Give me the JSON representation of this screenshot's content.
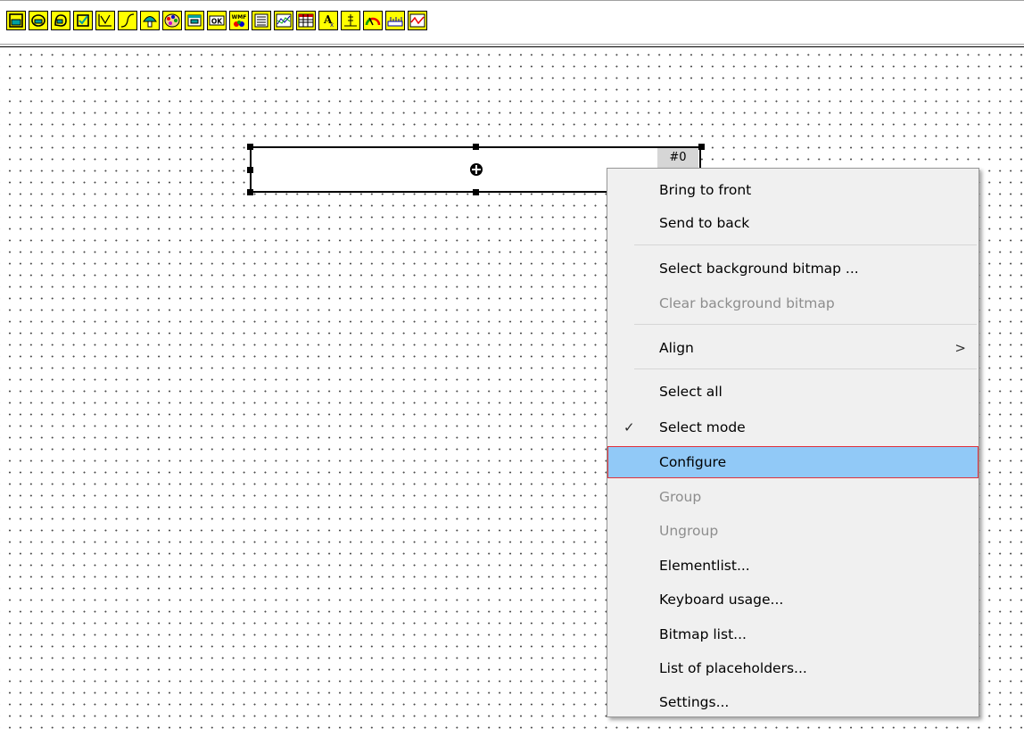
{
  "toolbar": {
    "icons": [
      "frame-icon",
      "ellipse-button-icon",
      "shape-button-icon",
      "checkbox-icon",
      "line-chart-icon",
      "curve-icon",
      "mushroom-icon",
      "palette-icon",
      "window-icon",
      "ok-button-icon",
      "wmf-icon",
      "list-icon",
      "trend-chart-icon",
      "table-icon",
      "text-icon",
      "level-icon",
      "gauge-icon",
      "ruler-icon",
      "graph-icon"
    ],
    "ok_label": "OK",
    "wmf_label": "WMF"
  },
  "element": {
    "id_badge": "#0"
  },
  "context_menu": {
    "items": [
      {
        "label": "Bring to front",
        "disabled": false
      },
      {
        "label": "Send to back",
        "disabled": false
      },
      {
        "label": "Select background bitmap ...",
        "disabled": false
      },
      {
        "label": "Clear background bitmap",
        "disabled": true
      },
      {
        "label": "Align",
        "disabled": false,
        "submenu_glyph": ">"
      },
      {
        "label": "Select all",
        "disabled": false
      },
      {
        "label": "Select mode",
        "disabled": false,
        "checked_glyph": "✓"
      },
      {
        "label": "Configure",
        "disabled": false,
        "highlighted": true
      },
      {
        "label": "Group",
        "disabled": true
      },
      {
        "label": "Ungroup",
        "disabled": true
      },
      {
        "label": "Elementlist...",
        "disabled": false
      },
      {
        "label": "Keyboard usage...",
        "disabled": false
      },
      {
        "label": "Bitmap list...",
        "disabled": false
      },
      {
        "label": "List of placeholders...",
        "disabled": false
      },
      {
        "label": "Settings...",
        "disabled": false
      }
    ]
  },
  "colors": {
    "toolbar_icon_bg": "#ffff00",
    "menu_highlight": "#91c9f7",
    "menu_highlight_border": "#e0323c",
    "disabled_text": "#8d8d8d"
  }
}
